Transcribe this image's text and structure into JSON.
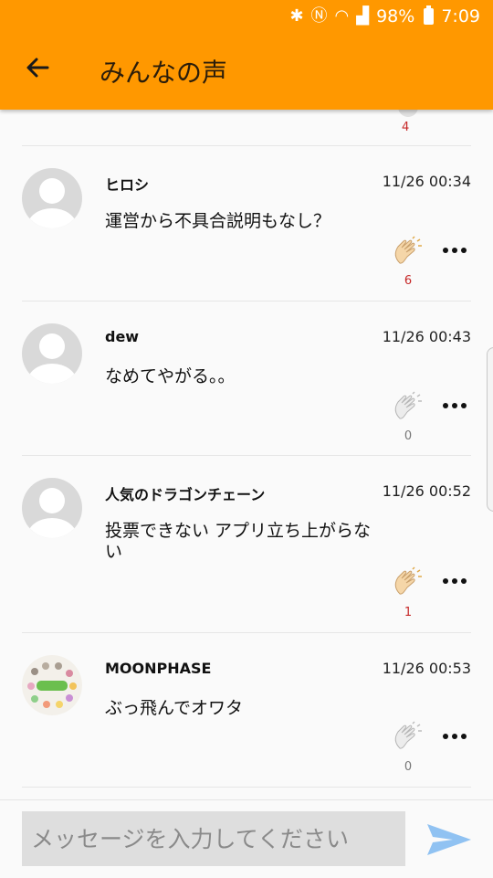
{
  "status_bar": {
    "battery": "98%",
    "time": "7:09"
  },
  "header": {
    "title": "みんなの声"
  },
  "top_partial": {
    "count": "4"
  },
  "comments": [
    {
      "name": "ヒロシ",
      "time": "11/26 00:34",
      "text": "運営から不具合説明もなし？",
      "claps": "6",
      "clapped": true
    },
    {
      "name": "dew",
      "time": "11/26 00:43",
      "text": "なめてやがる。。",
      "claps": "0",
      "clapped": false
    },
    {
      "name": "人気のドラゴンチェーン",
      "time": "11/26 00:52",
      "text": "投票できない アプリ立ち上がらない",
      "claps": "1",
      "clapped": true
    },
    {
      "name": "MOONPHASE",
      "time": "11/26 00:53",
      "text": "ぶっ飛んでオワタ",
      "claps": "0",
      "clapped": false
    }
  ],
  "input": {
    "placeholder": "メッセージを入力してください"
  },
  "colors": {
    "accent": "#ff9800",
    "send": "#90c2f2",
    "clap_red": "#c62828"
  },
  "icons": [
    "back-arrow-icon",
    "clap-icon",
    "more-icon",
    "send-icon",
    "avatar-placeholder-icon"
  ]
}
